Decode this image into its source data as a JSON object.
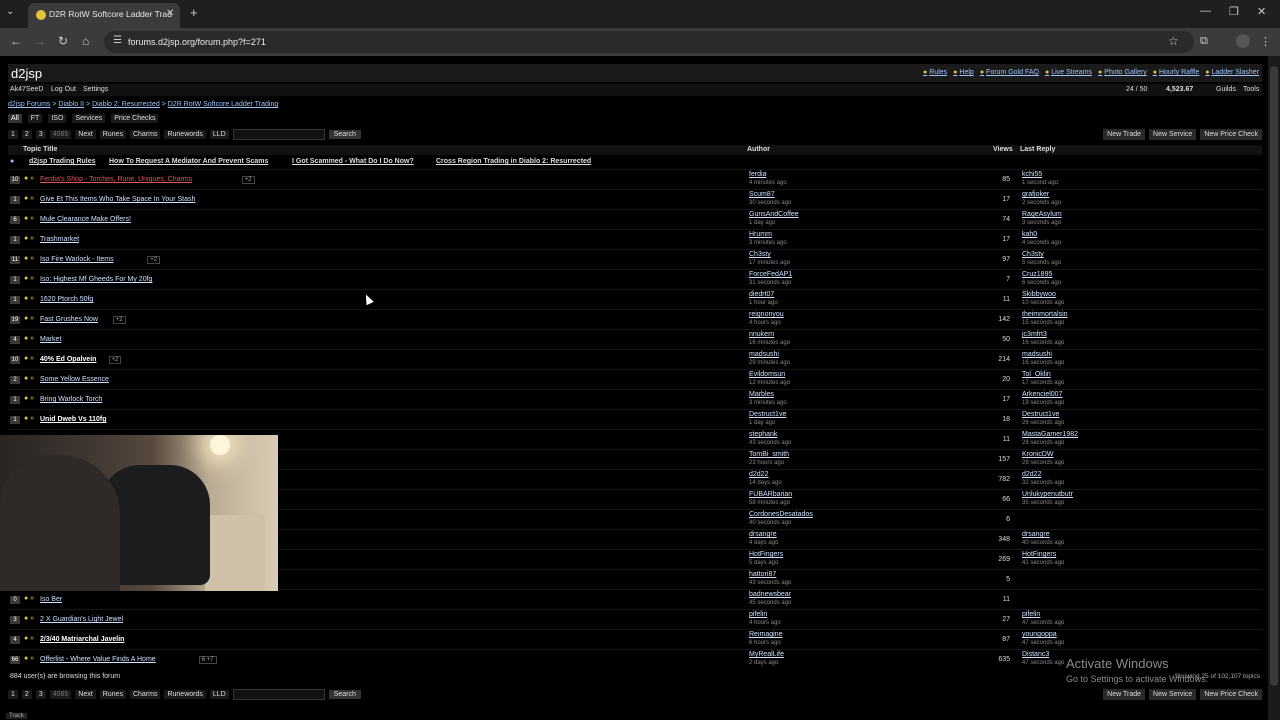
{
  "browser": {
    "tab_title": "D2R RotW Softcore Ladder Trad",
    "url": "forums.d2jsp.org/forum.php?f=271"
  },
  "site": {
    "logo": "d2jsp",
    "top_links": [
      "Rules",
      "Help",
      "Forum Gold FAQ",
      "Live Streams",
      "Photo Gallery",
      "Hourly Raffle",
      "Ladder Slasher"
    ],
    "user": "Ak47SeeD",
    "logout": "Log Out",
    "settings": "Settings",
    "counter": "24 / 50",
    "gold": "4,523.67",
    "guilds": "Guilds",
    "tools": "Tools"
  },
  "breadcrumb": [
    "d2jsp Forums",
    "Diablo II",
    "Diablo 2: Resurrected",
    "D2R RotW Softcore Ladder Trading"
  ],
  "filters": [
    "All",
    "FT",
    "ISO",
    "Services",
    "Price Checks"
  ],
  "pager": {
    "pages": [
      "1",
      "2",
      "3"
    ],
    "last": "4085",
    "next": "Next",
    "links": [
      "Runes",
      "Charms",
      "Runewords",
      "LLD"
    ],
    "search": "Search"
  },
  "actions": [
    "New Trade",
    "New Service",
    "New Price Check"
  ],
  "columns": {
    "topic": "Topic Title",
    "author": "Author",
    "views": "Views",
    "last": "Last Reply"
  },
  "stickies": [
    "d2jsp Trading Rules",
    "How To Request A Mediator And Prevent Scams",
    "I Got Scammed - What Do I Do Now?",
    "Cross Region Trading in Diablo 2: Resurrected"
  ],
  "topics": [
    {
      "count": "10",
      "title": "Ferdia's Shop - Torches, Rune, Uniques, Charms",
      "style": "red",
      "pages": "+2",
      "author": "ferdia",
      "author_time": "4 minutes ago",
      "views": "85",
      "last": "kchi55",
      "last_time": "1 second ago"
    },
    {
      "count": "1",
      "title": "Give Et This Items Who Take Space In Your Stash",
      "style": "",
      "pages": "",
      "author": "Scum87",
      "author_time": "30 seconds ago",
      "views": "17",
      "last": "grafjoker",
      "last_time": "2 seconds ago"
    },
    {
      "count": "6",
      "title": "Mule Clearance Make Offers!",
      "style": "",
      "pages": "",
      "author": "GunsAndCoffee",
      "author_time": "1 day ago",
      "views": "74",
      "last": "RageAsylum",
      "last_time": "3 seconds ago"
    },
    {
      "count": "1",
      "title": "Trashmarket",
      "style": "",
      "pages": "",
      "author": "Hrumm",
      "author_time": "3 minutes ago",
      "views": "17",
      "last": "kah0",
      "last_time": "4 seconds ago"
    },
    {
      "count": "11",
      "title": "Iso Fire Warlock - Items",
      "style": "",
      "pages": "+2",
      "author": "Ch3sty",
      "author_time": "17 minutes ago",
      "views": "97",
      "last": "Ch3sty",
      "last_time": "5 seconds ago"
    },
    {
      "count": "1",
      "title": "Iso: Highest Mf Gheeds For My 20fg",
      "style": "",
      "pages": "",
      "author": "ForceFedAP1",
      "author_time": "31 seconds ago",
      "views": "7",
      "last": "Cruz1895",
      "last_time": "6 seconds ago"
    },
    {
      "count": "1",
      "title": "1620 Ptorch 50fg",
      "style": "",
      "pages": "",
      "author": "diedrt07",
      "author_time": "1 hour ago",
      "views": "11",
      "last": "Skibbywoo",
      "last_time": "10 seconds ago"
    },
    {
      "count": "19",
      "title": "Fast Grushes Now",
      "style": "",
      "pages": "+2",
      "author": "reignonyou",
      "author_time": "4 hours ago",
      "views": "142",
      "last": "theimmortalsin",
      "last_time": "15 seconds ago"
    },
    {
      "count": "4",
      "title": "Market",
      "style": "",
      "pages": "",
      "author": "nnukern",
      "author_time": "16 minutes ago",
      "views": "50",
      "last": "jc3mfrt3",
      "last_time": "16 seconds ago"
    },
    {
      "count": "10",
      "title": "40% Ed Opalvein",
      "style": "bold",
      "pages": "+2",
      "author": "madsushi",
      "author_time": "29 minutes ago",
      "views": "214",
      "last": "madsushi",
      "last_time": "16 seconds ago"
    },
    {
      "count": "2",
      "title": "Some Yellow Essence",
      "style": "",
      "pages": "",
      "author": "Evildomsun",
      "author_time": "12 minutes ago",
      "views": "20",
      "last": "Tol_Oklin",
      "last_time": "17 seconds ago"
    },
    {
      "count": "1",
      "title": "Bring Warlock Torch",
      "style": "",
      "pages": "",
      "author": "Marbles",
      "author_time": "3 minutes ago",
      "views": "17",
      "last": "Arkenciel007",
      "last_time": "19 seconds ago"
    },
    {
      "count": "1",
      "title": "Unid Dweb Vs 110fg",
      "style": "bold",
      "pages": "",
      "author": "Destruct1ve",
      "author_time": "1 day ago",
      "views": "18",
      "last": "Destruct1ve",
      "last_time": "26 seconds ago"
    },
    {
      "count": "",
      "title": "",
      "style": "",
      "pages": "",
      "author": "stephank",
      "author_time": "43 seconds ago",
      "views": "11",
      "last": "MastaGamer1982",
      "last_time": "28 seconds ago"
    },
    {
      "count": "",
      "title": "",
      "style": "",
      "pages": "",
      "author": "TomBi_smith",
      "author_time": "23 hours ago",
      "views": "157",
      "last": "KronicDW",
      "last_time": "29 seconds ago"
    },
    {
      "count": "",
      "title": "",
      "style": "",
      "pages": "",
      "author": "d2d22",
      "author_time": "14 days ago",
      "views": "782",
      "last": "d2d22",
      "last_time": "32 seconds ago"
    },
    {
      "count": "",
      "title": "",
      "style": "",
      "pages": "",
      "author": "FUBARbarian",
      "author_time": "58 minutes ago",
      "views": "66",
      "last": "Unlukypenutbutr",
      "last_time": "35 seconds ago"
    },
    {
      "count": "",
      "title": "",
      "style": "",
      "pages": "",
      "author": "CordonesDesatados",
      "author_time": "40 seconds ago",
      "views": "6",
      "last": "",
      "last_time": ""
    },
    {
      "count": "",
      "title": "",
      "style": "",
      "pages": "",
      "author": "drsangre",
      "author_time": "4 days ago",
      "views": "348",
      "last": "drsangre",
      "last_time": "40 seconds ago"
    },
    {
      "count": "",
      "title": "",
      "style": "",
      "pages": "",
      "author": "HotFingers",
      "author_time": "5 days ago",
      "views": "269",
      "last": "HotFingers",
      "last_time": "41 seconds ago"
    },
    {
      "count": "",
      "title": "",
      "style": "",
      "pages": "",
      "author": "hattori87",
      "author_time": "43 seconds ago",
      "views": "5",
      "last": "",
      "last_time": ""
    },
    {
      "count": "0",
      "title": "Iso Ber",
      "style": "",
      "pages": "",
      "author": "badnewsbear",
      "author_time": "45 seconds ago",
      "views": "11",
      "last": "",
      "last_time": ""
    },
    {
      "count": "3",
      "title": "2 X Guardian's Light Jewel",
      "style": "",
      "pages": "",
      "author": "pifelin",
      "author_time": "4 hours ago",
      "views": "27",
      "last": "pifelin",
      "last_time": "47 seconds ago"
    },
    {
      "count": "4",
      "title": "2/3/40 Matriarchal Javelin",
      "style": "bold",
      "pages": "",
      "author": "Reimagine",
      "author_time": "6 hours ago",
      "views": "87",
      "last": "youngoppa",
      "last_time": "47 seconds ago"
    },
    {
      "count": "66",
      "title": "Offerlist - Where Value Finds A Home",
      "style": "",
      "pages": "6 +7",
      "author": "MyRealLife",
      "author_time": "2 days ago",
      "views": "635",
      "last": "Distanc3",
      "last_time": "47 seconds ago"
    }
  ],
  "footer": {
    "browsing": "884 user(s) are browsing this forum",
    "showing": "Showing 25 of 102,107 topics",
    "activate_title": "Activate Windows",
    "activate_sub": "Go to Settings to activate Windows.",
    "track": "Track"
  }
}
